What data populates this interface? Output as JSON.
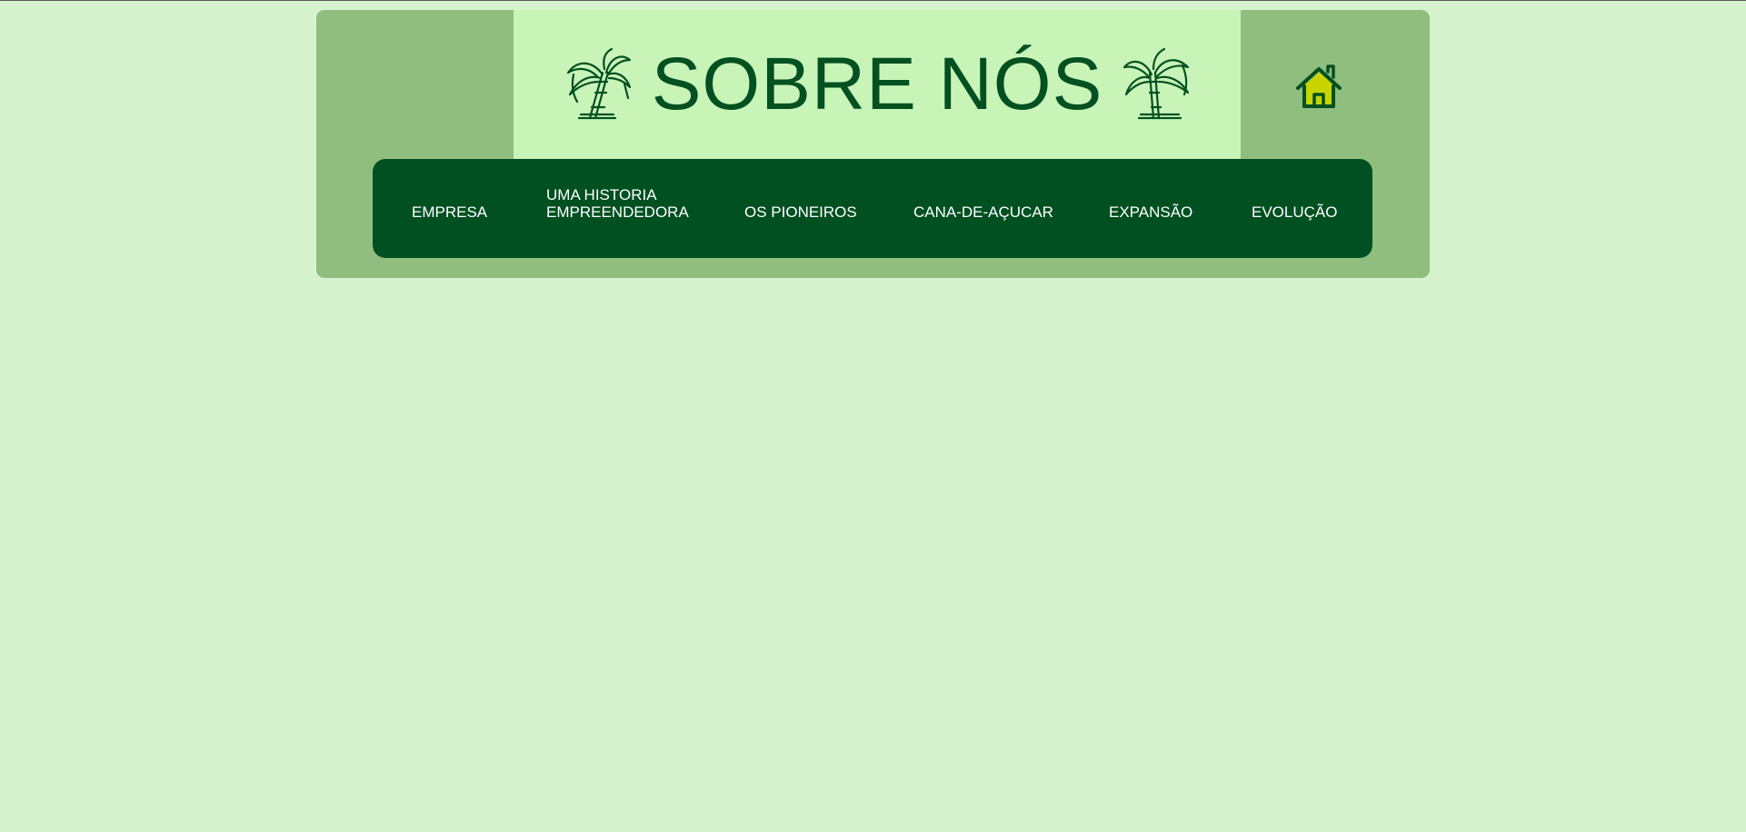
{
  "header": {
    "title": "SOBRE NÓS",
    "left_icon": "sugarcane-icon",
    "right_icon": "sugarcane-icon",
    "home_icon": "home-icon"
  },
  "nav": {
    "items": [
      {
        "line1": "EMPRESA",
        "line2": ""
      },
      {
        "line1": "UMA HISTORIA",
        "line2": "EMPREENDEDORA"
      },
      {
        "line1": "OS PIONEIROS",
        "line2": ""
      },
      {
        "line1": "CANA-DE-AÇUCAR",
        "line2": ""
      },
      {
        "line1": "EXPANSÃO",
        "line2": ""
      },
      {
        "line1": "EVOLUÇÃO",
        "line2": ""
      }
    ]
  },
  "colors": {
    "page_background": "#d7f2cf",
    "header_panel": "#90be7e",
    "title_box": "#c8f4b8",
    "title_text": "#035021",
    "nav_background": "#015021",
    "nav_text": "#ffffff",
    "home_fill": "#c8d400"
  }
}
